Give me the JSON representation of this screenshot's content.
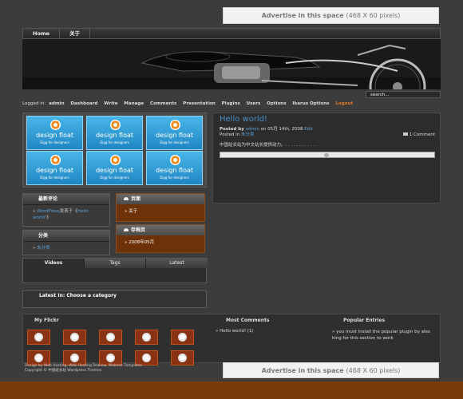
{
  "ads": {
    "text": "Advertise in this space",
    "size": "(468 X 60 pixels)"
  },
  "nav": {
    "home": "Home",
    "about": "关于"
  },
  "header": {
    "search_placeholder": "search..."
  },
  "admin_bar": {
    "logged_in": "Logged in:",
    "items": [
      "admin",
      "Dashboard",
      "Write",
      "Manage",
      "Comments",
      "Presentation",
      "Plugins",
      "Users",
      "Options",
      "Ikarus Options"
    ],
    "logout": "Logout"
  },
  "design_float": {
    "title": "design float",
    "subtitle": "Digg for designers"
  },
  "recent_comments": {
    "title": "最新评论",
    "line1_user": "WordPress",
    "line1_mid": "发表于《",
    "line1_link": "Hello",
    "line2_link": "world!",
    "line2_end": "》"
  },
  "categories": {
    "title": "分类",
    "item": "未分类"
  },
  "pages_box": {
    "title": "页面",
    "item": "关于"
  },
  "archives_box": {
    "title": "存档页",
    "item": "2008年05月"
  },
  "post": {
    "title": "Hello world!",
    "posted_by_label": "Posted by",
    "author": "admin",
    "date": "on 05月 14th, 2008",
    "edit": "Edit",
    "posted_in_label": "Posted in",
    "category": "未分类",
    "comment_count": "1 Comment",
    "body": "中国站长站为中文站长提供动力。. . . . . . . . . . . ."
  },
  "tabs": [
    "Videos",
    "Tags",
    "Latest"
  ],
  "latest_in": "Latest In: Choose a category",
  "footer": {
    "flickr_title": "My Flickr",
    "most_comments_title": "Most Comments",
    "most_comments_item": "Hello world! (1)",
    "popular_title": "Popular Entries",
    "popular_text": "you must install the popular plugin by alex king for this section to work"
  },
  "copyright": {
    "line1": "Design by Web Hosting, Web Hosting Rewiew, Website Templates",
    "line2": "Copyright © 中国站长站 Wordpress Themes"
  }
}
